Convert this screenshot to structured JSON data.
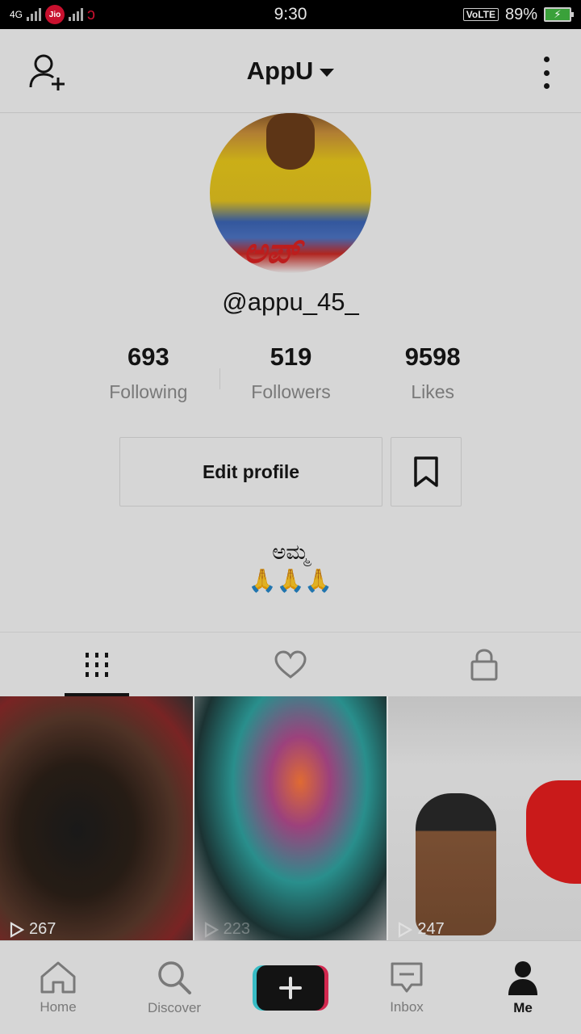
{
  "status": {
    "carrier_badge": "Jio",
    "time": "9:30",
    "network": "4G",
    "volte": "VoLTE",
    "battery": "89%",
    "battery_color": "#3aa13a"
  },
  "header": {
    "title": "AppU",
    "add_user_icon": "person-add-icon",
    "menu_icon": "more-vertical-icon"
  },
  "profile": {
    "handle": "@appu_45_",
    "avatar_mark": "ಅಪ್",
    "stats": [
      {
        "value": "693",
        "label": "Following"
      },
      {
        "value": "519",
        "label": "Followers"
      },
      {
        "value": "9598",
        "label": "Likes"
      }
    ],
    "edit_label": "Edit profile",
    "bookmark_icon": "bookmark-icon",
    "bio_line1": "ಅಮ್ಮ",
    "bio_line2": "🙏🙏🙏"
  },
  "tabs": [
    {
      "icon": "grid-icon"
    },
    {
      "icon": "heart-icon"
    },
    {
      "icon": "lock-icon"
    }
  ],
  "videos": [
    {
      "views": "267"
    },
    {
      "views": "223"
    },
    {
      "views": "247"
    }
  ],
  "nav": [
    {
      "label": "Home",
      "icon": "home-icon"
    },
    {
      "label": "Discover",
      "icon": "search-icon"
    },
    {
      "label": "",
      "icon": "plus-icon"
    },
    {
      "label": "Inbox",
      "icon": "inbox-icon"
    },
    {
      "label": "Me",
      "icon": "profile-icon"
    }
  ],
  "colors": {
    "accent_cyan": "#3fd6e1",
    "accent_pink": "#ee2e5b",
    "text": "#161616",
    "muted": "#8a8a8a"
  }
}
